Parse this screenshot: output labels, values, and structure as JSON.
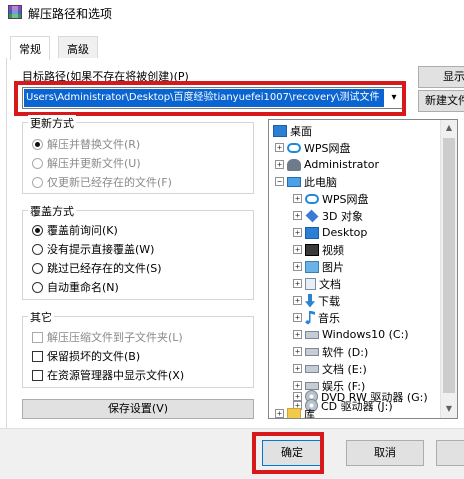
{
  "window": {
    "title": "解压路径和选项"
  },
  "tabs": [
    {
      "label": "常规"
    },
    {
      "label": "高级"
    }
  ],
  "destination": {
    "label": "目标路径(如果不存在将被创建)(P)",
    "path": "Users\\Administrator\\Desktop\\百度经验tianyuefei1007\\recovery\\测试文件",
    "show_button": "显示",
    "new_folder_button": "新建文件"
  },
  "update_mode": {
    "title": "更新方式",
    "options": [
      {
        "label": "解压并替换文件(R)",
        "selected": true,
        "disabled": true
      },
      {
        "label": "解压并更新文件(U)",
        "selected": false,
        "disabled": true
      },
      {
        "label": "仅更新已经存在的文件(F)",
        "selected": false,
        "disabled": true
      }
    ]
  },
  "overwrite_mode": {
    "title": "覆盖方式",
    "options": [
      {
        "label": "覆盖前询问(K)",
        "selected": true
      },
      {
        "label": "没有提示直接覆盖(W)",
        "selected": false
      },
      {
        "label": "跳过已经存在的文件(S)",
        "selected": false
      },
      {
        "label": "自动重命名(N)",
        "selected": false
      }
    ]
  },
  "misc": {
    "title": "其它",
    "options": [
      {
        "label": "解压压缩文件到子文件夹(L)",
        "checked": false,
        "disabled": true
      },
      {
        "label": "保留损坏的文件(B)",
        "checked": false,
        "disabled": false
      },
      {
        "label": "在资源管理器中显示文件(X)",
        "checked": false,
        "disabled": false
      }
    ]
  },
  "save_settings_button": "保存设置(V)",
  "tree": {
    "items": [
      {
        "label": "桌面",
        "icon": "desktop-icon",
        "expander": ""
      },
      {
        "label": "WPS网盘",
        "icon": "cloud-icon",
        "expander": "+"
      },
      {
        "label": "Administrator",
        "icon": "user-icon",
        "expander": "+"
      },
      {
        "label": "此电脑",
        "icon": "computer-icon",
        "expander": "−"
      },
      {
        "label": "WPS网盘",
        "icon": "cloud-icon",
        "expander": "+"
      },
      {
        "label": "3D 对象",
        "icon": "3d-objects-icon",
        "expander": "+"
      },
      {
        "label": "Desktop",
        "icon": "desktop-icon",
        "expander": "+"
      },
      {
        "label": "视频",
        "icon": "video-icon",
        "expander": "+"
      },
      {
        "label": "图片",
        "icon": "pictures-icon",
        "expander": "+"
      },
      {
        "label": "文档",
        "icon": "documents-icon",
        "expander": "+"
      },
      {
        "label": "下载",
        "icon": "downloads-icon",
        "expander": "+"
      },
      {
        "label": "音乐",
        "icon": "music-icon",
        "expander": "+"
      },
      {
        "label": "Windows10 (C:)",
        "icon": "drive-icon",
        "expander": "+"
      },
      {
        "label": "软件 (D:)",
        "icon": "drive-icon",
        "expander": "+"
      },
      {
        "label": "文档 (E:)",
        "icon": "drive-icon",
        "expander": "+"
      },
      {
        "label": "娱乐 (F:)",
        "icon": "drive-icon",
        "expander": "+"
      },
      {
        "label": "DVD RW 驱动器 (G:)",
        "icon": "dvd-icon",
        "expander": "+"
      },
      {
        "label": "CD 驱动器 (J:)",
        "icon": "dvd-icon",
        "expander": "+"
      },
      {
        "label": "库",
        "icon": "folder-icon",
        "expander": "+"
      }
    ]
  },
  "footer": {
    "ok_button": "确定",
    "cancel_button": "取消"
  },
  "colors": {
    "highlight": "#d7191c",
    "selection": "#0a64d2"
  }
}
